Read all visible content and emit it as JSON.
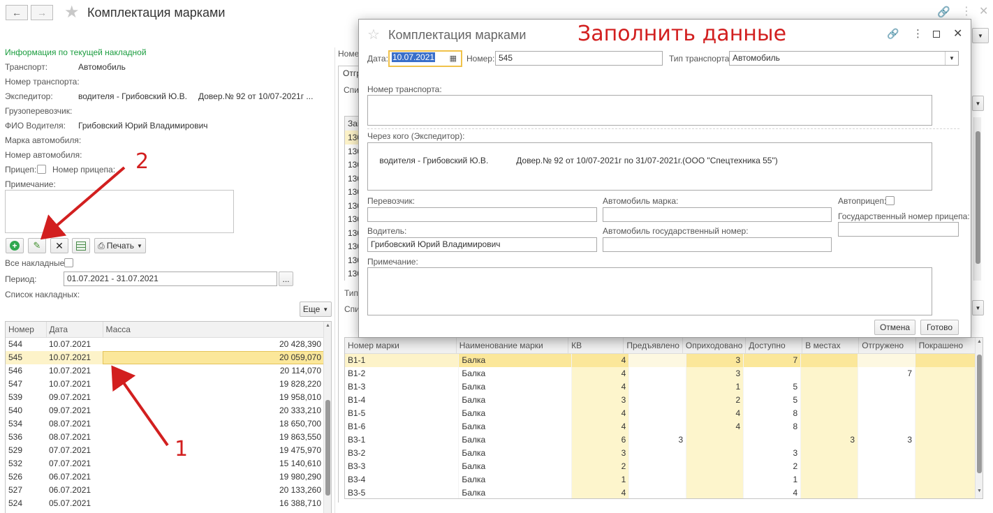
{
  "window": {
    "title": "Комплектация марками",
    "more_btn": "Еще"
  },
  "left": {
    "section_title": "Информация по текущей накладной",
    "labels": {
      "transport": "Транспорт:",
      "transport_number": "Номер транспорта:",
      "forwarder": "Экспедитор:",
      "carrier": "Грузоперевозчик:",
      "driver": "ФИО Водителя:",
      "car_brand": "Марка автомобиля:",
      "car_number": "Номер автомобиля:",
      "trailer": "Прицеп:",
      "trailer_number": "Номер прицепа:",
      "note": "Примечание:"
    },
    "values": {
      "transport": "Автомобиль",
      "forwarder": "водителя - Грибовский Ю.В.",
      "forwarder_proxy": "Довер.№ 92 от 10/07-2021г ...",
      "driver": "Грибовский Юрий Владимирович"
    },
    "print_btn": "Печать",
    "all_invoices_label": "Все накладные:",
    "period_label": "Период:",
    "period_value": "01.07.2021 - 31.07.2021",
    "period_btn": "...",
    "list_label": "Список накладных:",
    "more_btn": "Еще",
    "table": {
      "headers": [
        "Номер",
        "Дата",
        "Масса"
      ],
      "rows": [
        [
          "544",
          "10.07.2021",
          "20 428,390"
        ],
        [
          "545",
          "10.07.2021",
          "20 059,070"
        ],
        [
          "546",
          "10.07.2021",
          "20 114,070"
        ],
        [
          "547",
          "10.07.2021",
          "19 828,220"
        ],
        [
          "539",
          "09.07.2021",
          "19 958,010"
        ],
        [
          "540",
          "09.07.2021",
          "20 333,210"
        ],
        [
          "534",
          "08.07.2021",
          "18 650,700"
        ],
        [
          "536",
          "08.07.2021",
          "19 863,550"
        ],
        [
          "529",
          "07.07.2021",
          "19 475,970"
        ],
        [
          "532",
          "07.07.2021",
          "15 140,610"
        ],
        [
          "526",
          "06.07.2021",
          "19 980,290"
        ],
        [
          "527",
          "06.07.2021",
          "20 133,260"
        ],
        [
          "524",
          "05.07.2021",
          "16 388,710"
        ]
      ]
    }
  },
  "middle": {
    "label_nomer": "Номер",
    "tab_otgr": "Отгр",
    "label_spis": "Спис",
    "label_zai": "Заі",
    "label_tip": "Тип",
    "label_spi": "Спи",
    "codes": [
      "130",
      "130",
      "130",
      "130",
      "130",
      "130",
      "130",
      "130",
      "130",
      "130",
      "130"
    ]
  },
  "bottom_table": {
    "headers": [
      "Номер марки",
      "Наименование марки",
      "КВ",
      "Предъявлено",
      "Оприходовано",
      "Доступно",
      "В местах",
      "Отгружено",
      "Покрашено"
    ],
    "rows": [
      [
        "В1-1",
        "Балка",
        "4",
        "",
        "3",
        "7",
        "",
        "",
        ""
      ],
      [
        "В1-2",
        "Балка",
        "4",
        "",
        "3",
        "",
        "",
        "7",
        ""
      ],
      [
        "В1-3",
        "Балка",
        "4",
        "",
        "1",
        "5",
        "",
        "",
        ""
      ],
      [
        "В1-4",
        "Балка",
        "3",
        "",
        "2",
        "5",
        "",
        "",
        ""
      ],
      [
        "В1-5",
        "Балка",
        "4",
        "",
        "4",
        "8",
        "",
        "",
        ""
      ],
      [
        "В1-6",
        "Балка",
        "4",
        "",
        "4",
        "8",
        "",
        "",
        ""
      ],
      [
        "В3-1",
        "Балка",
        "6",
        "3",
        "",
        "",
        "3",
        "3",
        ""
      ],
      [
        "В3-2",
        "Балка",
        "3",
        "",
        "",
        "3",
        "",
        "",
        ""
      ],
      [
        "В3-3",
        "Балка",
        "2",
        "",
        "",
        "2",
        "",
        "",
        ""
      ],
      [
        "В3-4",
        "Балка",
        "1",
        "",
        "",
        "1",
        "",
        "",
        ""
      ],
      [
        "В3-5",
        "Балка",
        "4",
        "",
        "",
        "4",
        "",
        "",
        ""
      ]
    ]
  },
  "dialog": {
    "title": "Комплектация марками",
    "annotation": "Заполнить данные",
    "date_label": "Дата:",
    "date_value": "10.07.2021",
    "number_label": "Номер:",
    "number_value": "545",
    "transport_type_label": "Тип транспорта:",
    "transport_type_value": "Автомобиль",
    "transport_number_label": "Номер транспорта:",
    "forwarder_label": "Через кого (Экспедитор):",
    "forwarder_value": "водителя - Грибовский Ю.В.            Довер.№ 92 от 10/07-2021г по 31/07-2021г.(ООО \"Спецтехника 55\")",
    "carrier_label": "Перевозчик:",
    "car_brand_label": "Автомобиль марка:",
    "trailer_label": "Автоприцеп:",
    "trailer_number_label": "Государственный номер прицепа:",
    "driver_label": "Водитель:",
    "driver_value": "Грибовский Юрий Владимирович",
    "car_number_label": "Автомобиль государственный номер:",
    "note_label": "Примечание:",
    "cancel_btn": "Отмена",
    "ok_btn": "Готово"
  },
  "annotations": {
    "num1": "1",
    "num2": "2"
  },
  "colors": {
    "accent_green": "#1a9c3e",
    "highlight_yellow": "#fbe79a",
    "annotation_red": "#d21f1f"
  }
}
